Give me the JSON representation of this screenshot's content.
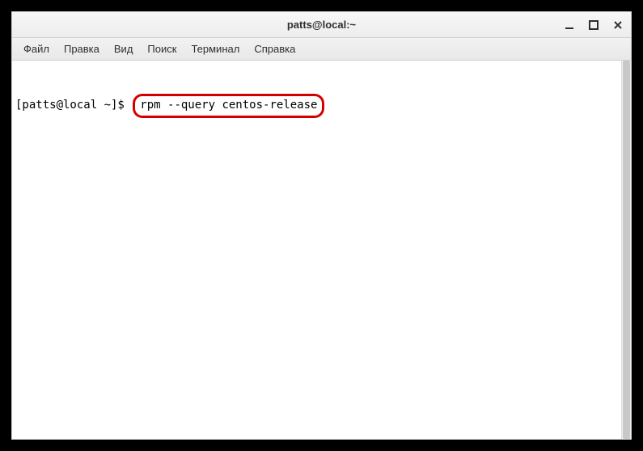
{
  "window": {
    "title": "patts@local:~"
  },
  "menubar": {
    "items": [
      {
        "label": "Файл"
      },
      {
        "label": "Правка"
      },
      {
        "label": "Вид"
      },
      {
        "label": "Поиск"
      },
      {
        "label": "Терминал"
      },
      {
        "label": "Справка"
      }
    ]
  },
  "terminal": {
    "prompt": "[patts@local ~]$ ",
    "command": "rpm --query centos-release"
  }
}
